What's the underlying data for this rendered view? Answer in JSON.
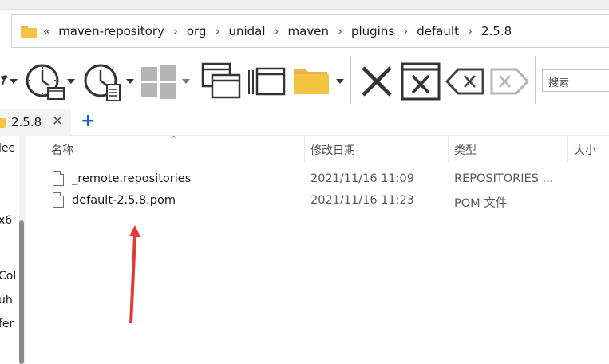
{
  "address": {
    "overflow": "«",
    "crumbs": [
      "maven-repository",
      "org",
      "unidal",
      "maven",
      "plugins",
      "default",
      "2.5.8"
    ],
    "separator": "›"
  },
  "search": {
    "placeholder": "搜索"
  },
  "tabs": {
    "active_label": "2.5.8",
    "close_glyph": "✕",
    "add_glyph": "+"
  },
  "nav": {
    "fragments": [
      "lec",
      "x6",
      "Col",
      "uh",
      "fer"
    ]
  },
  "columns": {
    "name": "名称",
    "date": "修改日期",
    "type": "类型",
    "size": "大小"
  },
  "files": [
    {
      "name": "_remote.repositories",
      "date": "2021/11/16 11:09",
      "type": "REPOSITORIES ..."
    },
    {
      "name": "default-2.5.8.pom",
      "date": "2021/11/16 11:23",
      "type": "POM 文件"
    }
  ],
  "colors": {
    "folder": "#f5c342",
    "accent_blue": "#1a5fd1",
    "annotation_red": "#e53935"
  },
  "icons": [
    "folder-icon",
    "pin-icon",
    "history-open-icon",
    "history-properties-icon",
    "windows-icon",
    "new-window-icon",
    "window-list-icon",
    "folder-icon",
    "close-x-icon",
    "close-window-icon",
    "clear-left-icon",
    "clear-right-icon"
  ]
}
